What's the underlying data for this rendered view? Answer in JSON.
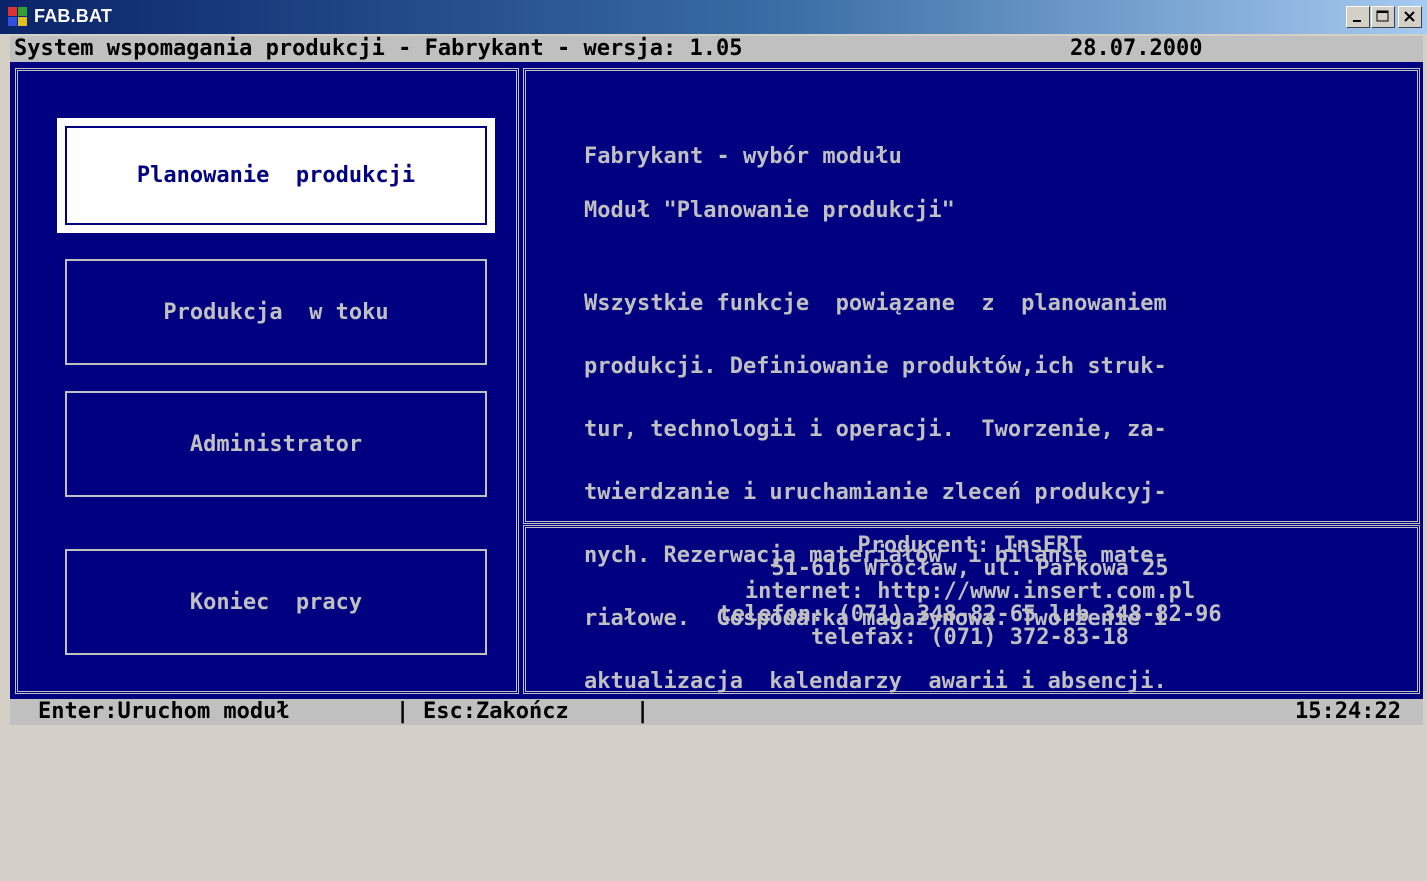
{
  "window": {
    "title": "FAB.BAT",
    "icon": "msdos-app-icon"
  },
  "header": {
    "title": "System wspomagania produkcji - Fabrykant - wersja: 1.05",
    "date": "28.07.2000"
  },
  "menu": {
    "items": [
      {
        "label": "Planowanie  produkcji",
        "selected": true
      },
      {
        "label": "Produkcja  w toku",
        "selected": false
      },
      {
        "label": "Administrator",
        "selected": false
      },
      {
        "label": "Koniec  pracy",
        "selected": false
      }
    ]
  },
  "info": {
    "heading": "Fabrykant - wybór modułu",
    "module": "Moduł \"Planowanie produkcji\"",
    "description_lines": [
      "Wszystkie funkcje  powiązane  z  planowaniem",
      "produkcji. Definiowanie produktów,ich struk-",
      "tur, technologii i operacji.  Tworzenie, za-",
      "twierdzanie i uruchamianie zleceń produkcyj-",
      "nych. Rezerwacja materiałów  i bilanse mate-",
      "riałowe.  Gospodarka magazynowa. Tworzenie i",
      "aktualizacja  kalendarzy  awarii i absencji."
    ]
  },
  "producer": {
    "lines": [
      "Producent: InsERT",
      "51-616 Wrocław, ul. Parkowa 25",
      "internet: http://www.insert.com.pl",
      "telefon: (071) 348-82-65 lub 348-82-96",
      "telefax: (071) 372-83-18"
    ]
  },
  "statusbar": {
    "enter_hint": "Enter:Uruchom moduł",
    "separator": "|",
    "esc_hint": "Esc:Zakończ",
    "time": "15:24:22"
  },
  "colors": {
    "background": "#000080",
    "text": "#c0c0c0",
    "bar": "#c0c0c0",
    "selected_bg": "#ffffff"
  }
}
